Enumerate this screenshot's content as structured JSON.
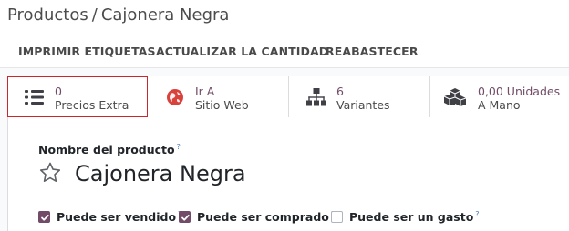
{
  "breadcrumb": {
    "parent": "Productos",
    "separator": "/",
    "current": "Cajonera Negra"
  },
  "actions": {
    "print_labels": "IMPRIMIR ETIQUETAS",
    "update_qty": "ACTUALIZAR LA CANTIDAD",
    "replenish": "REABASTECER"
  },
  "smart_buttons": [
    {
      "icon": "list-icon",
      "value": "0",
      "label": "Precios Extra"
    },
    {
      "icon": "globe-icon",
      "value": "Ir A",
      "label": "Sitio Web"
    },
    {
      "icon": "sitemap-icon",
      "value": "6",
      "label": "Variantes"
    },
    {
      "icon": "cubes-icon",
      "value": "0,00 Unidades",
      "label": "A Mano"
    }
  ],
  "form": {
    "name_label": "Nombre del producto",
    "help_mark": "?",
    "product_name": "Cajonera Negra",
    "checkboxes": [
      {
        "label": "Puede ser vendido",
        "checked": true
      },
      {
        "label": "Puede ser comprado",
        "checked": true
      },
      {
        "label": "Puede ser un gasto",
        "checked": false
      }
    ]
  },
  "colors": {
    "accent": "#714b67",
    "highlight_border": "#c9262e",
    "globe_red": "#d9413b"
  }
}
